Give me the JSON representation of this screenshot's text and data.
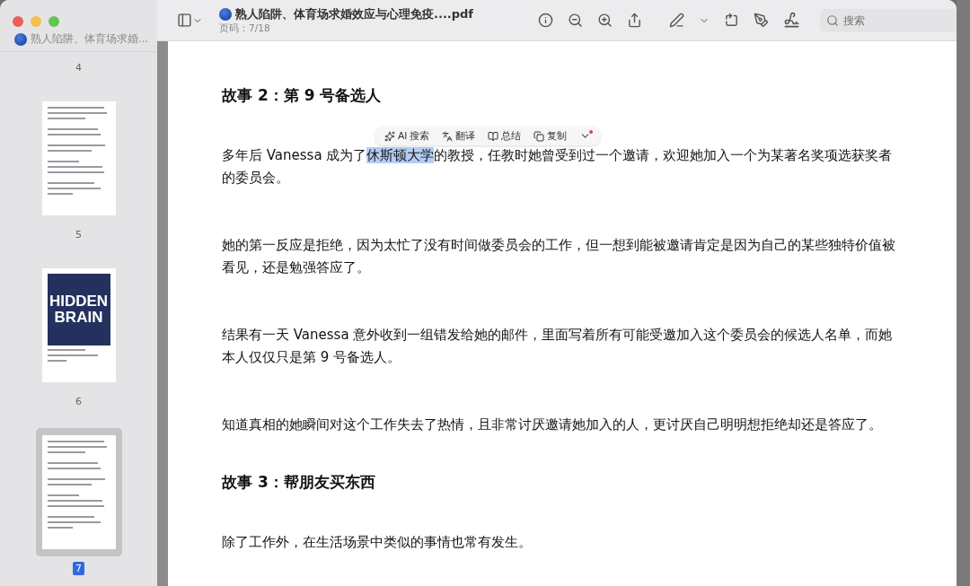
{
  "window": {
    "title": "熟人陷阱、体育场求婚效应与心理免疫....pdf",
    "subtitle": "页码：7/18"
  },
  "sidebar": {
    "title": "熟人陷阱、体育场求婚...",
    "thumbnails": [
      {
        "label": "4",
        "kind": "scrolled",
        "selected": false
      },
      {
        "label": "5",
        "kind": "text",
        "selected": false
      },
      {
        "label": "6",
        "kind": "cover",
        "cover_title": [
          "HIDDEN",
          "BRAIN"
        ],
        "selected": false
      },
      {
        "label": "7",
        "kind": "text",
        "selected": true
      }
    ]
  },
  "search": {
    "placeholder": "搜索"
  },
  "popover": {
    "items": [
      "AI 搜索",
      "翻译",
      "总结",
      "复制"
    ],
    "more_badge": true
  },
  "document": {
    "blocks": [
      {
        "kind": "heading",
        "text": "故事 2：第 9 号备选人"
      },
      {
        "kind": "paragraph",
        "before": "多年后 Vanessa 成为了",
        "selected_text": "休斯顿大学",
        "after": "的教授，任教时她曾受到过一个邀请，欢迎她加入一个为某著名奖项选获奖者的委员会。"
      },
      {
        "kind": "paragraph",
        "before": "她的第一反应是拒绝，因为太忙了没有时间做委员会的工作，但一想到能被邀请肯定是因为自己的某些独特价值被看见，还是勉强答应了。"
      },
      {
        "kind": "paragraph",
        "before": "结果有一天 Vanessa 意外收到一组错发给她的邮件，里面写着所有可能受邀加入这个委员会的候选人名单，而她本人仅仅只是第 9 号备选人。"
      },
      {
        "kind": "paragraph",
        "before": "知道真相的她瞬间对这个工作失去了热情，且非常讨厌邀请她加入的人，更讨厌自己明明想拒绝却还是答应了。"
      },
      {
        "kind": "heading",
        "text": "故事 3：帮朋友买东西"
      },
      {
        "kind": "paragraph",
        "before": "除了工作外，在生活场景中类似的事情也常有发生。"
      }
    ]
  }
}
